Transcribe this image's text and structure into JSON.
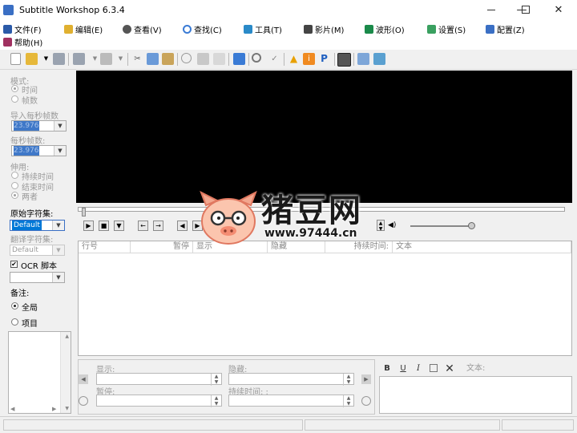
{
  "window": {
    "title": "Subtitle Workshop 6.3.4",
    "minimize": "—",
    "maximize": "☐",
    "close": "✕"
  },
  "menu": {
    "file": "文件(F)",
    "edit": "编辑(E)",
    "view": "查看(V)",
    "search": "查找(C)",
    "tools": "工具(T)",
    "movie": "影片(M)",
    "waveform": "波形(O)",
    "settings": "设置(S)",
    "config": "配置(Z)",
    "help": "帮助(H)"
  },
  "toolbar": {
    "ocr_letter": "P"
  },
  "left": {
    "mode_label": "模式:",
    "mode_time": "时间",
    "mode_frames": "帧数",
    "input_fps_label": "导入每秒帧数",
    "input_fps_value": "23.976",
    "fps_label": "每秒帧数:",
    "fps_value": "23.976",
    "stretch_label": "伸用:",
    "stretch_duration": "持续时间",
    "stretch_end": "结束时间",
    "stretch_both": "两者",
    "orig_charset_label": "原始字符集:",
    "orig_charset_value": "Default",
    "trans_charset_label": "翻译字符集:",
    "trans_charset_value": "Default",
    "ocr_label": "OCR 脚本",
    "ocr_check": "✔",
    "notes_label": "备注:",
    "notes_global": "全局",
    "notes_item": "项目"
  },
  "list": {
    "columns": [
      "行号",
      "暂停",
      "显示",
      "隐藏",
      "持续时间:",
      "文本"
    ]
  },
  "editor": {
    "show_label": "显示:",
    "hide_label": "隐藏:",
    "pause_label": "暂停:",
    "duration_label": "持续时间: :",
    "text_label": "文本:",
    "bold": "B",
    "underline": "U",
    "italic": "I"
  },
  "watermark": {
    "brand": "猪豆网",
    "url": "www.97444.cn"
  },
  "colors": {
    "accent": "#1f6fd6",
    "selection": "#0078d7",
    "video_bg": "#000000",
    "warning": "#e8a000"
  }
}
